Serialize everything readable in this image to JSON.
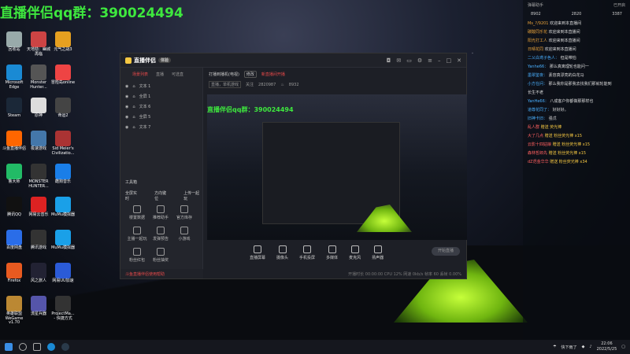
{
  "overlay": {
    "text": "直播伴侣qq群：390024494"
  },
  "desktop_icons": [
    {
      "label": "回收站",
      "color": "#9aa"
    },
    {
      "label": "天地劫：幽城再临",
      "color": "#c44"
    },
    {
      "label": "元气之战3",
      "color": "#e6a020"
    },
    {
      "label": "Microsoft Edge",
      "color": "#1a8ad4"
    },
    {
      "label": "Monster Hunter...",
      "color": "#555"
    },
    {
      "label": "冒险岛online",
      "color": "#e44"
    },
    {
      "label": "Steam",
      "color": "#1b2838"
    },
    {
      "label": "原神",
      "color": "#ddd"
    },
    {
      "label": "命运2",
      "color": "#444"
    },
    {
      "label": "斗鱼直播伴侣",
      "color": "#f60"
    },
    {
      "label": "极速游戏",
      "color": "#47a"
    },
    {
      "label": "Sid Meier's Civilizatio...",
      "color": "#a33"
    },
    {
      "label": "鲁大师",
      "color": "#2b6"
    },
    {
      "label": "MONSTER HUNTER...",
      "color": "#333"
    },
    {
      "label": "酷狗音乐",
      "color": "#1a7ee8"
    },
    {
      "label": "腾讯QQ",
      "color": "#111"
    },
    {
      "label": "网易云音乐",
      "color": "#d22"
    },
    {
      "label": "MuMu模拟器",
      "color": "#1aa0e8"
    },
    {
      "label": "百度网盘",
      "color": "#2a6de8"
    },
    {
      "label": "腾讯游戏",
      "color": "#333"
    },
    {
      "label": "MuMu模拟器",
      "color": "#1aa0e8"
    },
    {
      "label": "Firefox",
      "color": "#e85a20"
    },
    {
      "label": "风之旅人",
      "color": "#223"
    },
    {
      "label": "网易UU加速",
      "color": "#2b5bd7"
    },
    {
      "label": "英雄联盟WeGame v1.70",
      "color": "#b83"
    },
    {
      "label": "流星兵器",
      "color": "#55a"
    },
    {
      "label": "ProjectMa... - 快捷方式",
      "color": "#333"
    }
  ],
  "app": {
    "name": "直播伴侣",
    "badge": "体验",
    "titlebar_icons": [
      "shirt-icon",
      "message-icon",
      "screen-icon",
      "gear-icon",
      "menu-icon",
      "minimize-icon",
      "maximize-icon",
      "close-icon"
    ],
    "scene_tabs": [
      "场景列表",
      "直播",
      "可选直"
    ],
    "sources": [
      "文本 1",
      "全屏 1",
      "文本 6",
      "全屏 5",
      "文本 7"
    ],
    "room_title": "打播到播机(电视)",
    "room_btn": "修改",
    "room_warn": "新直播间开播",
    "room_category": "直播，单机游戏",
    "room_fans_label": "关注",
    "room_fans": "2820987",
    "room_hot": "8932",
    "tools_title": "工具箱",
    "tool_row1": [
      "全屏实时",
      "方向键位",
      "上传一起玩"
    ],
    "grid_tools": [
      "楼置数据",
      "推荐助手",
      "官方库存",
      "主播一起玩",
      "发弹预告",
      "小游戏",
      "粉丝红包",
      "粉丝抽奖"
    ],
    "notice": "斗鱼直播伴侣使用帮助",
    "bottom_tools": [
      "直播屏幕",
      "摄像头",
      "手机投屏",
      "多媒体",
      "麦克风",
      "扬声器"
    ],
    "start_btn": "开始直播",
    "status": "开播时长 00:00:00  CPU 12%  网速 0kb/s  帧率 60  丢帧 0.00%"
  },
  "chat": {
    "title": "弹幕助手",
    "title_right": "已开启",
    "stats": [
      "8902",
      "2820",
      "3387"
    ],
    "messages": [
      {
        "name": "Ms_?/9201",
        "text": "欢迎来到本直播间",
        "style": "nm"
      },
      {
        "name": "碳酸同乐花",
        "text": "欢迎来到本直播间",
        "style": "nm"
      },
      {
        "name": "阳光打工人",
        "text": "欢迎来到本直播间",
        "style": "nm"
      },
      {
        "name": "日晴花同",
        "text": "欢迎来到本直播间",
        "style": "nm"
      },
      {
        "name": "二乂白鸢子色人：",
        "text": "但是带怕",
        "style": "nm2"
      },
      {
        "name": "Yanhe66：",
        "text": "那么真离理轮也能问一",
        "style": "nm2"
      },
      {
        "name": "墨翠鉴夜：",
        "text": "素容真漂亮的白花马",
        "style": "nm2"
      },
      {
        "name": "小方在问：",
        "text": "那么我你是那我去找我们那就轮能到",
        "style": "nm2"
      },
      {
        "name": "",
        "text": "长生不老",
        "style": ""
      },
      {
        "name": "YanHe66：",
        "text": "八成客户你都做那那样也",
        "style": "nm2"
      },
      {
        "name": "道尊花同了：",
        "text": "好好好。",
        "style": "nm2"
      },
      {
        "name": "旧神卡旧：",
        "text": "强戊",
        "style": "nm2"
      },
      {
        "name": "乱人群",
        "text": "赠送 荧光棒",
        "style": "gold"
      },
      {
        "name": "大了几点",
        "text": "赠送 粉丝荧光棒 x15",
        "style": "gold"
      },
      {
        "name": "云影十四姑娘",
        "text": "赠送 粉丝荧光棒 x15",
        "style": "gold"
      },
      {
        "name": "森林哲郎先",
        "text": "赠送 粉丝荧光棒 x15",
        "style": "gold"
      },
      {
        "name": "dZ范金华华",
        "text": "赠送 粉丝荧光棒 x34",
        "style": "gold"
      }
    ]
  },
  "taskbar": {
    "apps": [
      "windows-icon",
      "search-icon",
      "taskview-icon",
      "edge-icon",
      "steam-icon"
    ],
    "tray_text": "快下雨了",
    "time": "22:06",
    "date": "2022/5/25"
  }
}
